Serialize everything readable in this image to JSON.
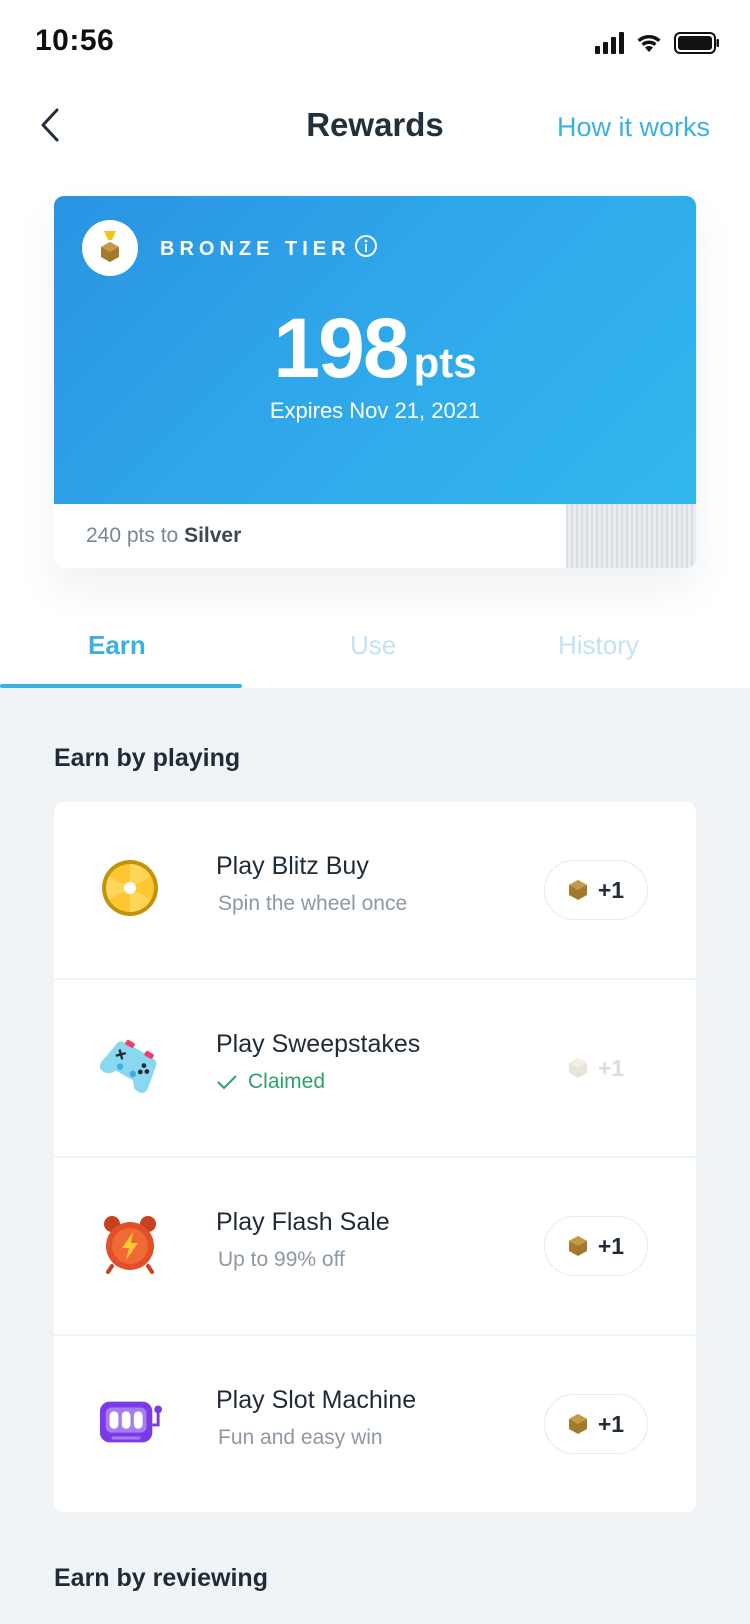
{
  "status": {
    "time": "10:56"
  },
  "nav": {
    "title": "Rewards",
    "how_it_works": "How it works"
  },
  "card": {
    "tier": "BRONZE TIER",
    "points": "198",
    "points_unit": "pts",
    "expires": "Expires Nov 21, 2021",
    "progress_prefix": "240 pts to",
    "progress_target": "Silver"
  },
  "tabs": [
    {
      "label": "Earn",
      "active": true
    },
    {
      "label": "Use",
      "active": false
    },
    {
      "label": "History",
      "active": false
    }
  ],
  "sections": {
    "earn_by_playing": "Earn by playing",
    "earn_by_reviewing": "Earn by reviewing"
  },
  "items": [
    {
      "title": "Play Blitz Buy",
      "subtitle": "Spin the wheel once",
      "reward": "+1",
      "icon": "wheel-icon",
      "claimed": false
    },
    {
      "title": "Play Sweepstakes",
      "subtitle": "Claimed",
      "reward": "+1",
      "icon": "gamepad-icon",
      "claimed": true
    },
    {
      "title": "Play Flash Sale",
      "subtitle": "Up to 99% off",
      "reward": "+1",
      "icon": "alarm-clock-icon",
      "claimed": false
    },
    {
      "title": "Play Slot Machine",
      "subtitle": "Fun and easy win",
      "reward": "+1",
      "icon": "slot-machine-icon",
      "claimed": false
    }
  ],
  "colors": {
    "accent": "#3ab2e0",
    "claimed": "#2ea06c",
    "coin": "#a17a2e"
  }
}
